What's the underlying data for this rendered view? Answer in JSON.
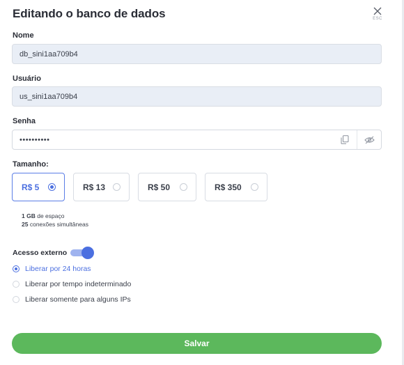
{
  "dialog": {
    "title": "Editando o banco de dados",
    "close_hint": "ESC"
  },
  "name": {
    "label": "Nome",
    "value": "db_sini1aa709b4"
  },
  "user": {
    "label": "Usuário",
    "value": "us_sini1aa709b4"
  },
  "password": {
    "label": "Senha",
    "value": "••••••••••"
  },
  "size": {
    "label": "Tamanho:",
    "options": [
      {
        "label": "R$ 5",
        "selected": true
      },
      {
        "label": "R$ 13",
        "selected": false
      },
      {
        "label": "R$ 50",
        "selected": false
      },
      {
        "label": "R$ 350",
        "selected": false
      }
    ],
    "storage_value": "1 GB",
    "storage_text": "de espaço",
    "connections_value": "25",
    "connections_text": "conexões simultâneas"
  },
  "external_access": {
    "label": "Acesso externo",
    "enabled": true,
    "options": [
      {
        "label": "Liberar por 24 horas",
        "selected": true
      },
      {
        "label": "Liberar por tempo indeterminado",
        "selected": false
      },
      {
        "label": "Liberar somente para alguns IPs",
        "selected": false
      }
    ]
  },
  "save_label": "Salvar",
  "colors": {
    "accent": "#4b6fe0",
    "save": "#5cb85c",
    "field_bg": "#e9eef6"
  }
}
